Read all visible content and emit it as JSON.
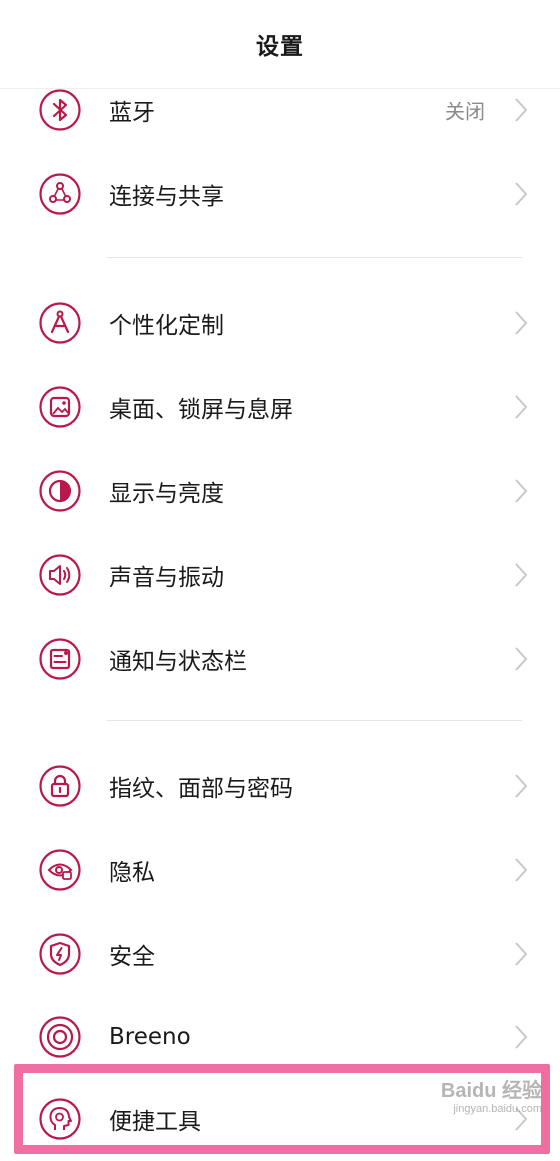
{
  "header": {
    "title": "设置"
  },
  "accent_color": "#b8194a",
  "highlight_color": "#f06fa2",
  "items": [
    {
      "icon": "bluetooth-icon",
      "label": "蓝牙",
      "value": "关闭"
    },
    {
      "icon": "share-icon",
      "label": "连接与共享"
    },
    {
      "icon": "compass-icon",
      "label": "个性化定制"
    },
    {
      "icon": "wallpaper-icon",
      "label": "桌面、锁屏与息屏"
    },
    {
      "icon": "contrast-icon",
      "label": "显示与亮度"
    },
    {
      "icon": "speaker-icon",
      "label": "声音与振动"
    },
    {
      "icon": "notification-icon",
      "label": "通知与状态栏"
    },
    {
      "icon": "lock-icon",
      "label": "指纹、面部与密码"
    },
    {
      "icon": "eye-lock-icon",
      "label": "隐私"
    },
    {
      "icon": "shield-bolt-icon",
      "label": "安全"
    },
    {
      "icon": "breeno-icon",
      "label": "Breeno"
    },
    {
      "icon": "head-gear-icon",
      "label": "便捷工具"
    }
  ],
  "watermark": {
    "main": "Baidu 经验",
    "sub": "jingyan.baidu.com"
  }
}
